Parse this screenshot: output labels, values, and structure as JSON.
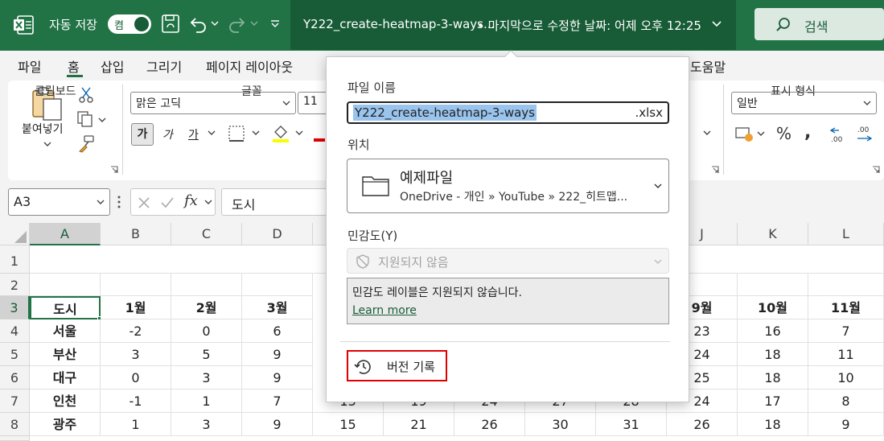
{
  "titlebar": {
    "autosave_label": "자동 저장",
    "autosave_state": "켬",
    "file_name": "Y222_create-heatmap-3-ways...",
    "last_modified": "• 마지막으로 수정한 날짜: 어제 오후 12:25",
    "search_label": "검색"
  },
  "menu": [
    "파일",
    "홈",
    "삽입",
    "그리기",
    "페이지 레이아웃",
    "도움말"
  ],
  "ribbon": {
    "paste_label": "붙여넣기",
    "clipboard_label": "클립보드",
    "font_name": "맑은 고딕",
    "font_size": "11",
    "bold": "가",
    "italic": "가",
    "underline": "가",
    "font_group_label": "글꼴",
    "number_format": "일반",
    "number_group_label": "표시 형식"
  },
  "formula": {
    "name_box": "A3",
    "fx": "fx",
    "value": "도시"
  },
  "grid": {
    "row_numbers": [
      "1",
      "2",
      "3",
      "4",
      "5",
      "6",
      "7",
      "8"
    ],
    "left_cols": [
      "A",
      "B",
      "C",
      "D"
    ],
    "right_cols": [
      "J",
      "K",
      "L"
    ],
    "row3_left": [
      "도시",
      "1월",
      "2월",
      "3월"
    ],
    "row3_right": [
      "9월",
      "10월",
      "11월"
    ],
    "left_rows": [
      [
        "서울",
        "-2",
        "0",
        "6"
      ],
      [
        "부산",
        "3",
        "5",
        "9"
      ],
      [
        "대구",
        "0",
        "3",
        "9"
      ],
      [
        "인천",
        "-1",
        "1",
        "7"
      ],
      [
        "광주",
        "1",
        "3",
        "9"
      ]
    ],
    "right_rows": [
      [
        "23",
        "16",
        "7"
      ],
      [
        "24",
        "18",
        "11"
      ],
      [
        "25",
        "18",
        "10"
      ],
      [
        "24",
        "17",
        "8"
      ],
      [
        "26",
        "18",
        "9"
      ]
    ],
    "row8_middle": [
      "15",
      "21",
      "26",
      "30",
      "31"
    ],
    "row7_middle": [
      "13",
      "19",
      "24",
      "27",
      "28"
    ]
  },
  "popup": {
    "file_name_label": "파일 이름",
    "file_name_value": "Y222_create-heatmap-3-ways",
    "file_ext": ".xlsx",
    "location_label": "위치",
    "location_title": "예제파일",
    "location_path": "OneDrive - 개인 » YouTube » 222_히트맵...",
    "sensitivity_label": "민감도(Y)",
    "sensitivity_value": "지원되지 않음",
    "sensitivity_message": "민감도 레이블은 지원되지 않습니다.",
    "learn_more": "Learn more",
    "version_history": "버전 기록"
  },
  "colors": {
    "excel_green": "#217346",
    "excel_dark_green": "#185c37",
    "highlight_red": "#e00000",
    "selection_blue": "#99c4ee"
  }
}
